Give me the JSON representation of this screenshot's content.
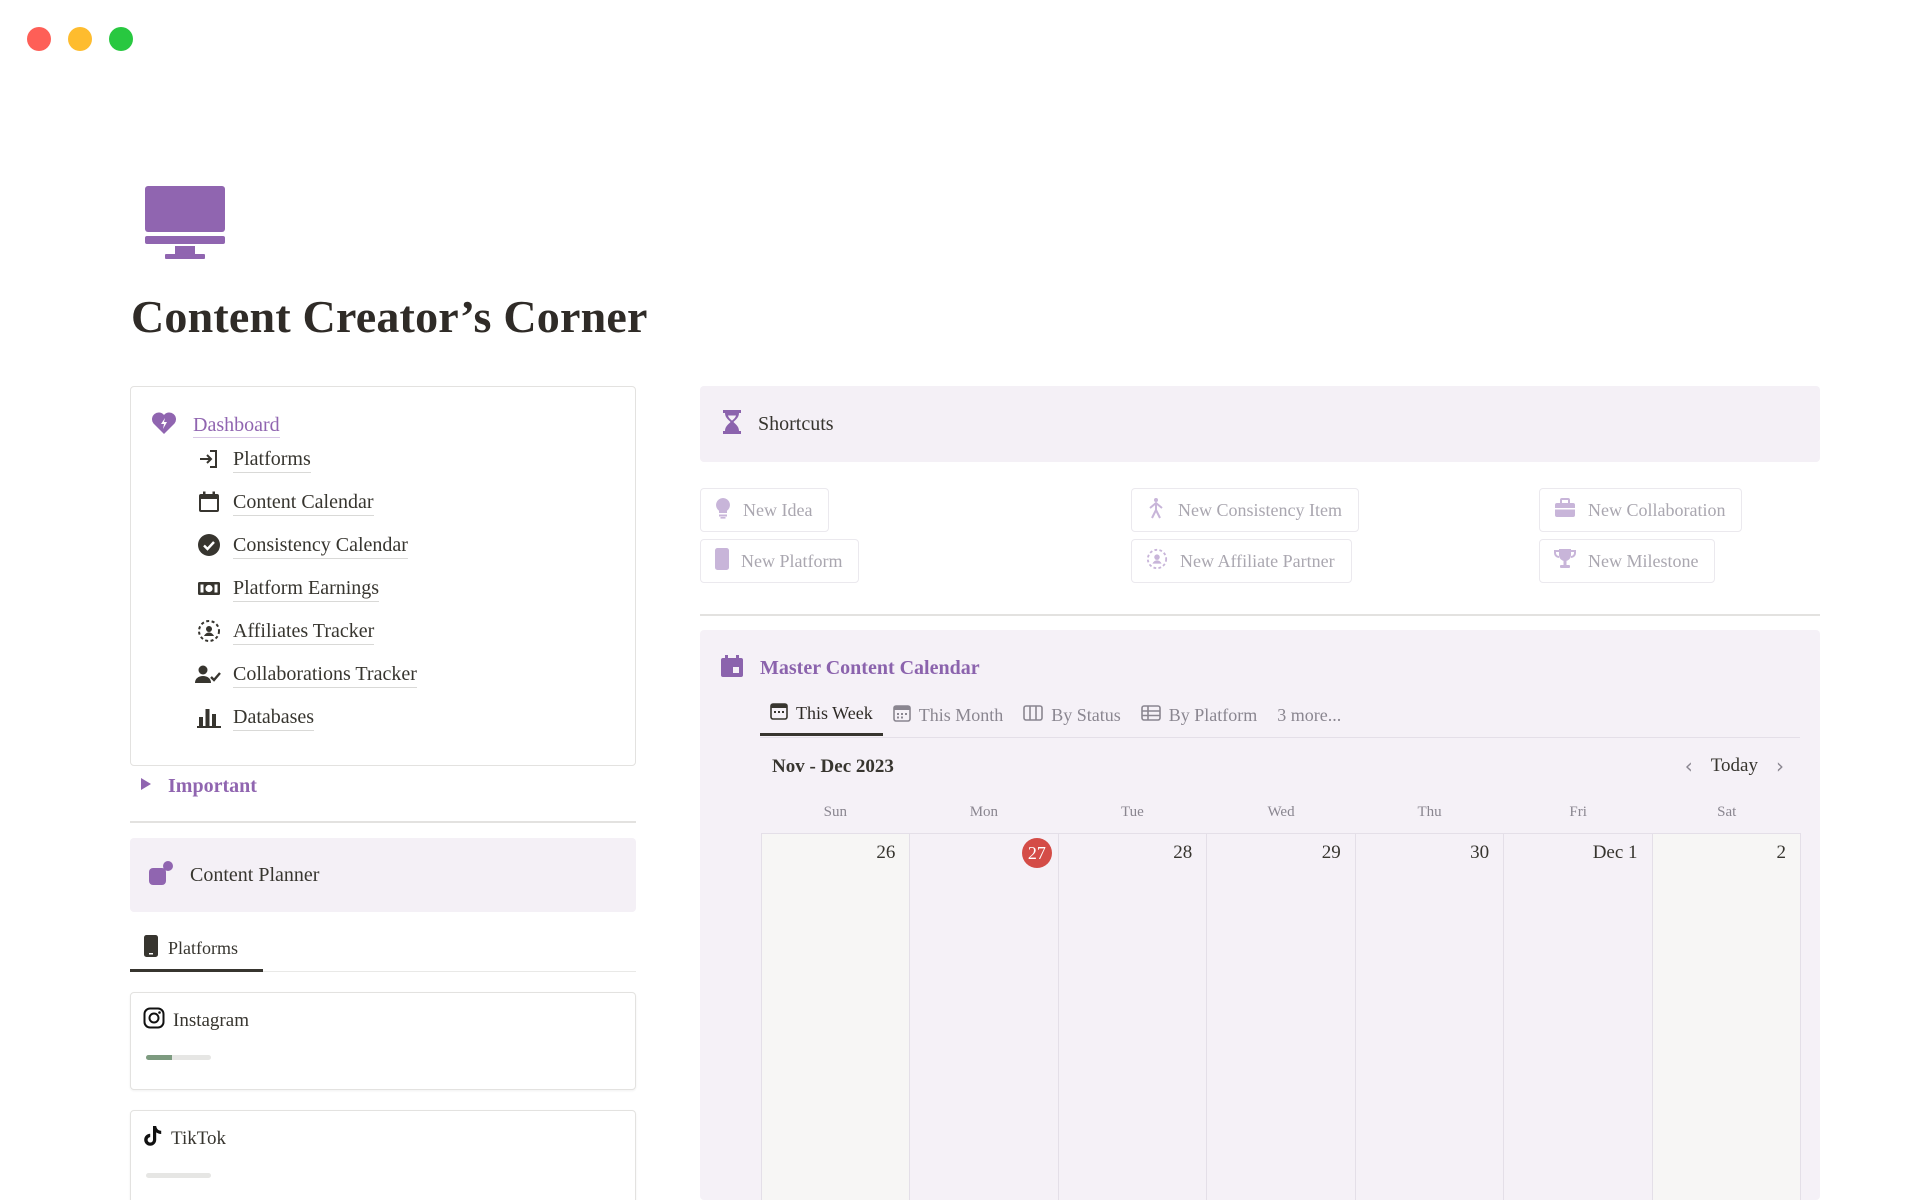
{
  "window": {
    "controls": [
      "close",
      "minimize",
      "zoom"
    ]
  },
  "page": {
    "title": "Content Creator’s Corner",
    "icon": "desktop-computer-icon",
    "accent": "#9065b0"
  },
  "toc": {
    "dashboard": "Dashboard",
    "items": [
      {
        "label": "Platforms",
        "icon": "login-arrow-icon"
      },
      {
        "label": "Content Calendar",
        "icon": "calendar-icon"
      },
      {
        "label": "Consistency Calendar",
        "icon": "check-circle-icon"
      },
      {
        "label": "Platform Earnings",
        "icon": "money-icon"
      },
      {
        "label": "Affiliates Tracker",
        "icon": "dashed-circle-user-icon"
      },
      {
        "label": "Collaborations Tracker",
        "icon": "user-check-icon"
      },
      {
        "label": "Databases",
        "icon": "bar-chart-icon"
      }
    ]
  },
  "important": {
    "label": "Important"
  },
  "planner": {
    "label": "Content Planner"
  },
  "platforms_tab": {
    "label": "Platforms"
  },
  "cards": [
    {
      "name": "Instagram",
      "progress": 0.4
    },
    {
      "name": "TikTok",
      "progress": 0
    }
  ],
  "shortcuts": {
    "title": "Shortcuts",
    "buttons": {
      "new_idea": "New Idea",
      "new_platform": "New Platform",
      "new_consistency": "New Consistency Item",
      "new_affiliate": "New Affiliate Partner",
      "new_collab": "New Collaboration",
      "new_milestone": "New Milestone"
    }
  },
  "calendar": {
    "title": "Master Content Calendar",
    "views": [
      "This Week",
      "This Month",
      "By Status",
      "By Platform",
      "3 more..."
    ],
    "active_view": "This Week",
    "range": "Nov - Dec 2023",
    "today_label": "Today",
    "weekdays": [
      "Sun",
      "Mon",
      "Tue",
      "Wed",
      "Thu",
      "Fri",
      "Sat"
    ],
    "days": [
      "26",
      "27",
      "28",
      "29",
      "30",
      "Dec 1",
      "2"
    ],
    "today_index": 1,
    "today_color": "#d44c47"
  }
}
